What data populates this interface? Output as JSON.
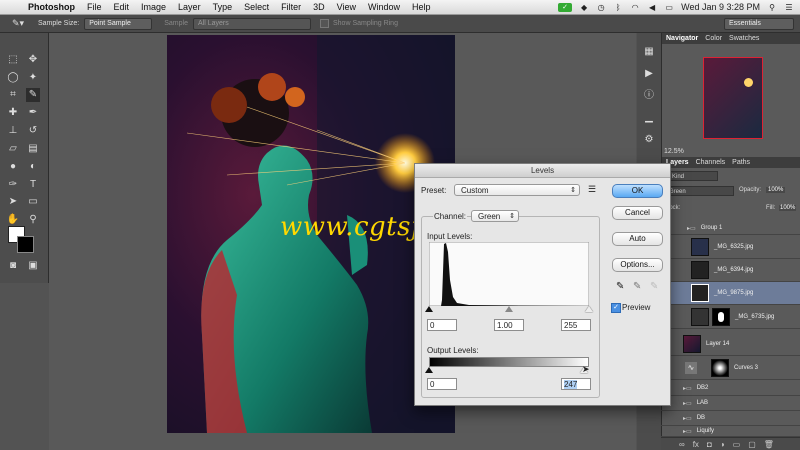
{
  "menubar": {
    "app": "Photoshop",
    "items": [
      "File",
      "Edit",
      "Image",
      "Layer",
      "Type",
      "Select",
      "Filter",
      "3D",
      "View",
      "Window",
      "Help"
    ],
    "clock": "Wed Jan 9  3:28 PM"
  },
  "options": {
    "sample_size_label": "Sample Size:",
    "sample_size_value": "Point Sample",
    "sample_label": "Sample",
    "sample_value": "All Layers",
    "sampling_ring_label": "Show Sampling Ring",
    "workspace": "Essentials"
  },
  "watermark": "www.cgtsj.com",
  "panels": {
    "tabs_top": [
      "Navigator",
      "Color",
      "Swatches"
    ],
    "zoom": "12.5%",
    "tabs_layers": [
      "Layers",
      "Channels",
      "Paths"
    ],
    "kind": "Kind",
    "blend": "Green",
    "opacity_label": "Opacity:",
    "opacity_value": "100%",
    "lock_label": "Lock:",
    "fill_label": "Fill:",
    "fill_value": "100%"
  },
  "layers": [
    {
      "name": "Group 1"
    },
    {
      "name": "_MG_6325.jpg"
    },
    {
      "name": "_MG_6394.jpg"
    },
    {
      "name": "_MG_9875.jpg"
    },
    {
      "name": "_MG_6735.jpg"
    },
    {
      "name": "Layer 14"
    },
    {
      "name": "Curves 3"
    },
    {
      "name": "DB2"
    },
    {
      "name": "LAB"
    },
    {
      "name": "DB"
    },
    {
      "name": "Liquify"
    }
  ],
  "dialog": {
    "title": "Levels",
    "preset_label": "Preset:",
    "preset_value": "Custom",
    "channel_label": "Channel:",
    "channel_value": "Green",
    "input_label": "Input Levels:",
    "input_black": "0",
    "input_gamma": "1.00",
    "input_white": "255",
    "output_label": "Output Levels:",
    "output_black": "0",
    "output_white": "247",
    "ok": "OK",
    "cancel": "Cancel",
    "auto": "Auto",
    "options": "Options...",
    "preview": "Preview"
  },
  "colors": {
    "ok_blue": "#5aa9f2",
    "watermark": "#ffd800",
    "ui_dark": "#4a4a4a"
  }
}
